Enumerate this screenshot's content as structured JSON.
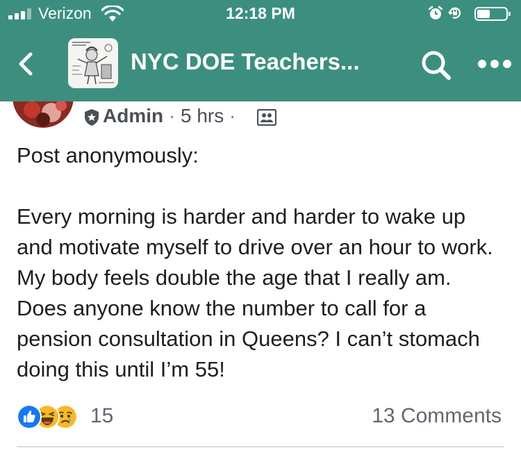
{
  "status_bar": {
    "carrier": "Verizon",
    "time": "12:18 PM"
  },
  "nav": {
    "group_title": "NYC DOE Teachers...",
    "back_icon": "chevron-left-icon",
    "search_icon": "search-icon",
    "more_icon": "more-dots-icon"
  },
  "post": {
    "author_role": "Admin",
    "separator": "·",
    "time_ago": "5 hrs",
    "body_first": "Post anonymously:",
    "body_second": "Every morning is harder and harder to wake up and motivate myself to drive over an hour to work. My body feels double the age that I really am. Does anyone know the number to call for a pension consultation in Queens? I can’t stomach doing this until I’m 55!",
    "reaction_count": "15",
    "comments_label": "13 Comments",
    "reactions": [
      "like",
      "haha",
      "sad"
    ]
  },
  "colors": {
    "header": "#3c8f7e",
    "like": "#1877f2",
    "emoji": "#f7b928"
  }
}
